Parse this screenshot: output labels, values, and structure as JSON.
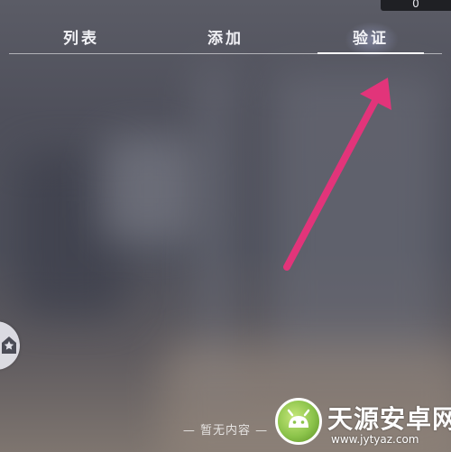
{
  "status": {
    "corner_value": "0"
  },
  "tabs": [
    {
      "label": "列表",
      "active": false
    },
    {
      "label": "添加",
      "active": false
    },
    {
      "label": "验证",
      "active": true
    }
  ],
  "empty_state": {
    "text": "— 暂无内容 —"
  },
  "watermark": {
    "name": "天源安卓网",
    "url": "www.jytyaz.com"
  },
  "colors": {
    "arrow": "#e2347a",
    "tab_text": "#f2f2f6",
    "side_button": "#e1e1e8"
  },
  "icons": {
    "side_button_icon": "home-badge-icon",
    "annotation": "pink-arrow-icon"
  }
}
